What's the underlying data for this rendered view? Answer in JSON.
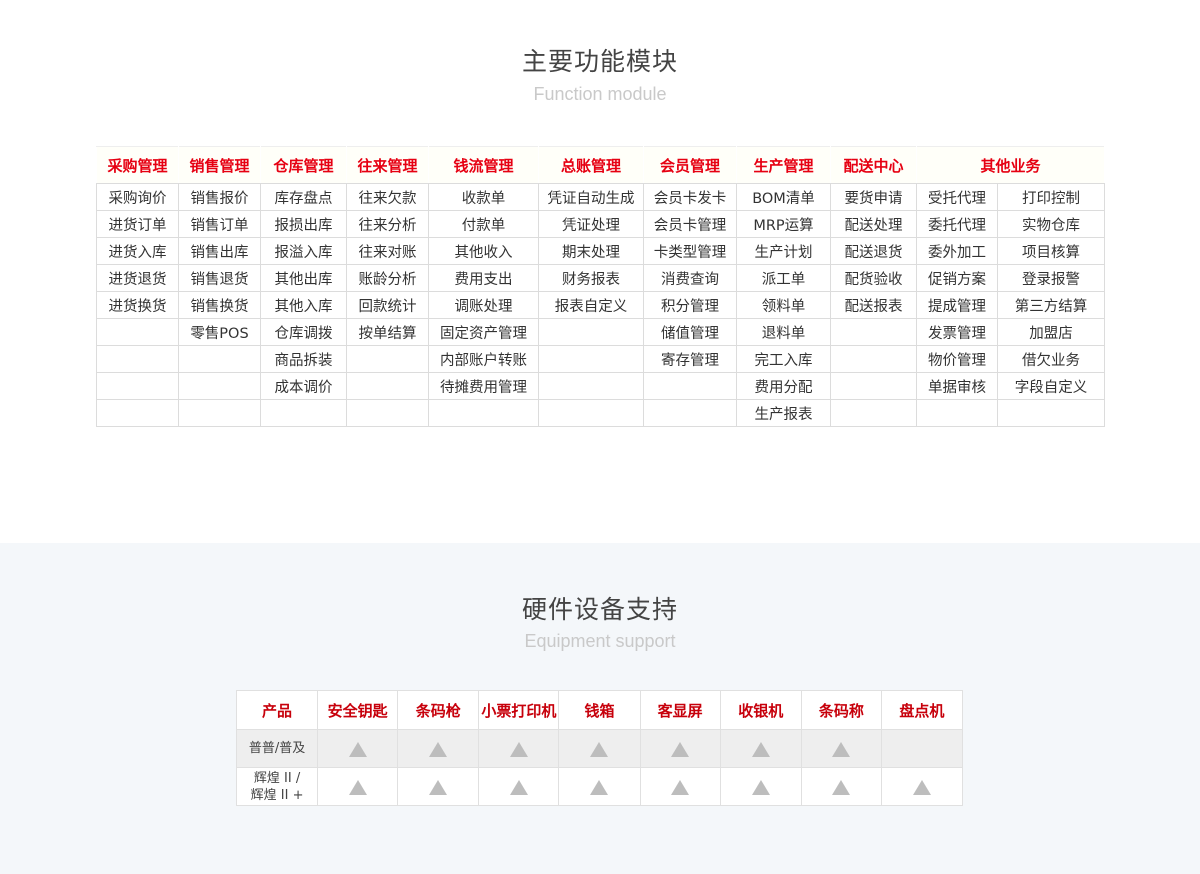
{
  "modules": {
    "title": "主要功能模块",
    "subtitle": "Function module",
    "headers": [
      "采购管理",
      "销售管理",
      "仓库管理",
      "往来管理",
      "钱流管理",
      "总账管理",
      "会员管理",
      "生产管理",
      "配送中心",
      "其他业务"
    ],
    "rows": [
      [
        "采购询价",
        "销售报价",
        "库存盘点",
        "往来欠款",
        "收款单",
        "凭证自动生成",
        "会员卡发卡",
        "BOM清单",
        "要货申请",
        "受托代理",
        "打印控制"
      ],
      [
        "进货订单",
        "销售订单",
        "报损出库",
        "往来分析",
        "付款单",
        "凭证处理",
        "会员卡管理",
        "MRP运算",
        "配送处理",
        "委托代理",
        "实物仓库"
      ],
      [
        "进货入库",
        "销售出库",
        "报溢入库",
        "往来对账",
        "其他收入",
        "期末处理",
        "卡类型管理",
        "生产计划",
        "配送退货",
        "委外加工",
        "项目核算"
      ],
      [
        "进货退货",
        "销售退货",
        "其他出库",
        "账龄分析",
        "费用支出",
        "财务报表",
        "消费查询",
        "派工单",
        "配货验收",
        "促销方案",
        "登录报警"
      ],
      [
        "进货换货",
        "销售换货",
        "其他入库",
        "回款统计",
        "调账处理",
        "报表自定义",
        "积分管理",
        "领料单",
        "配送报表",
        "提成管理",
        "第三方结算"
      ],
      [
        "",
        "零售POS",
        "仓库调拨",
        "按单结算",
        "固定资产管理",
        "",
        "储值管理",
        "退料单",
        "",
        "发票管理",
        "加盟店"
      ],
      [
        "",
        "",
        "商品拆装",
        "",
        "内部账户转账",
        "",
        "寄存管理",
        "完工入库",
        "",
        "物价管理",
        "借欠业务"
      ],
      [
        "",
        "",
        "成本调价",
        "",
        "待摊费用管理",
        "",
        "",
        "费用分配",
        "",
        "单据审核",
        "字段自定义"
      ],
      [
        "",
        "",
        "",
        "",
        "",
        "",
        "",
        "生产报表",
        "",
        "",
        ""
      ]
    ]
  },
  "equipment": {
    "title": "硬件设备支持",
    "subtitle": "Equipment support",
    "headers": [
      "产品",
      "安全钥匙",
      "条码枪",
      "小票打印机",
      "钱箱",
      "客显屏",
      "收银机",
      "条码称",
      "盘点机"
    ],
    "rows": [
      {
        "name": "普普/普及",
        "support": [
          true,
          true,
          true,
          true,
          true,
          true,
          true,
          false
        ]
      },
      {
        "name_line1": "辉煌 II /",
        "name_line2": "辉煌 II +",
        "support": [
          true,
          true,
          true,
          true,
          true,
          true,
          true,
          true
        ]
      }
    ],
    "support_icon": "triangle-icon",
    "support_color": "#bdbdbd"
  },
  "colors": {
    "header_red": "#e60012",
    "band_bg": "#f4f7fa"
  }
}
